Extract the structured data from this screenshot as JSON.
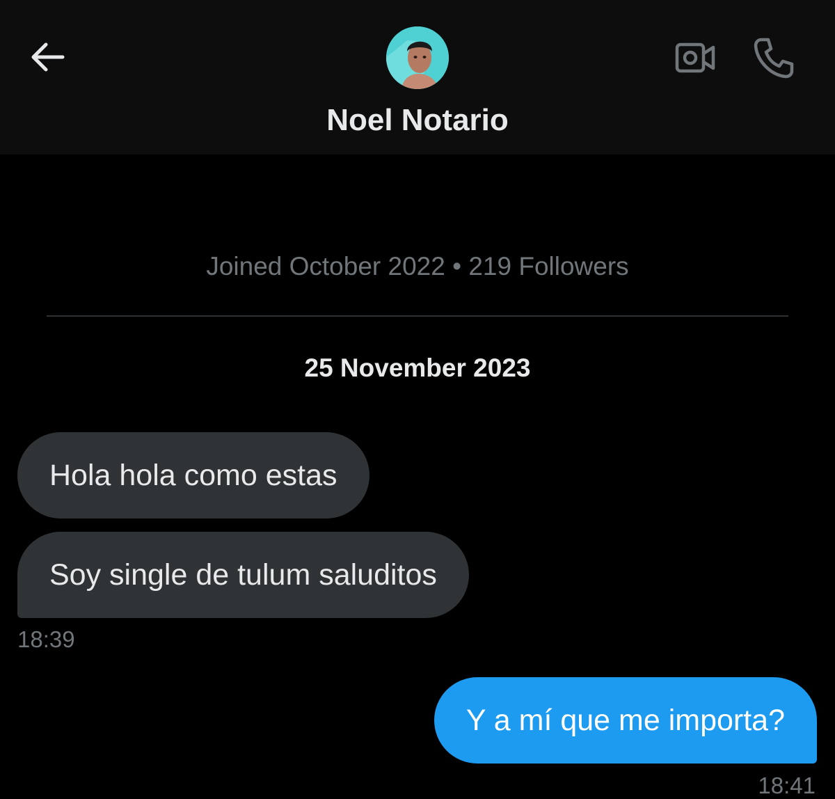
{
  "header": {
    "contact_name": "Noel Notario",
    "back_icon": "arrow-left-icon",
    "video_icon": "video-call-icon",
    "phone_icon": "phone-call-icon"
  },
  "profile": {
    "meta": "Joined October 2022 • 219 Followers"
  },
  "conversation": {
    "date": "25 November 2023",
    "incoming": [
      {
        "text": "Hola hola como estas"
      },
      {
        "text": "Soy single de tulum saluditos"
      }
    ],
    "incoming_time": "18:39",
    "outgoing": [
      {
        "text": "Y a mí que me importa?"
      }
    ],
    "outgoing_time": "18:41"
  },
  "colors": {
    "background": "#000000",
    "header": "#0d0d0d",
    "incoming_bubble": "#2f3336",
    "outgoing_bubble": "#1d9bf0",
    "muted_text": "#71767b"
  }
}
